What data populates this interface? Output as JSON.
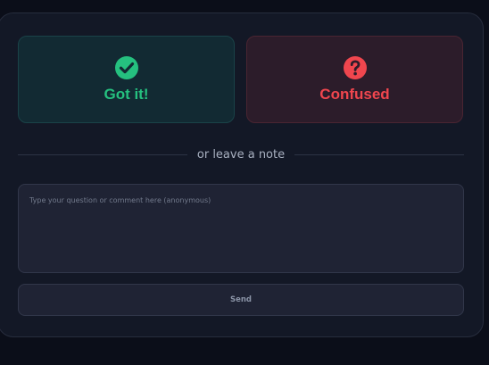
{
  "feedback": {
    "got_it": {
      "label": "Got it!",
      "icon": "check-circle-icon",
      "color": "#25c07f"
    },
    "confused": {
      "label": "Confused",
      "icon": "question-circle-icon",
      "color": "#f0464e"
    }
  },
  "divider": {
    "text": "or leave a note"
  },
  "note": {
    "value": "",
    "placeholder": "Type your question or comment here (anonymous)"
  },
  "send": {
    "label": "Send"
  }
}
